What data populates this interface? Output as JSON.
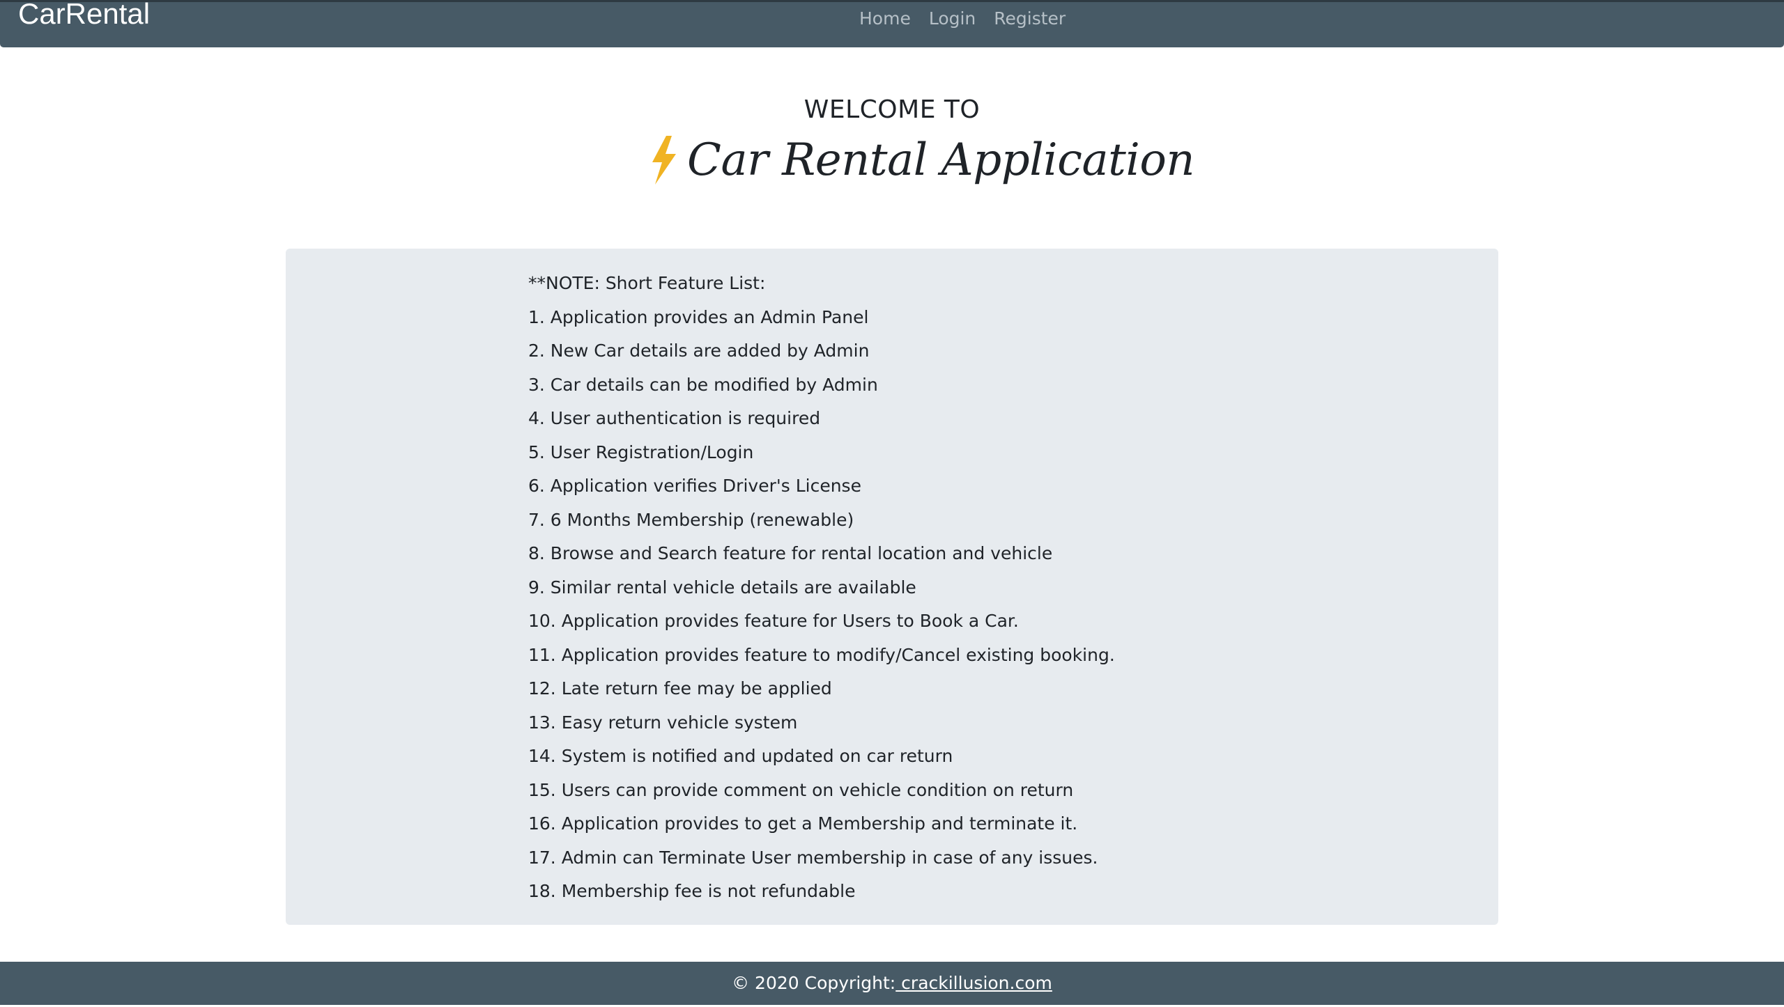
{
  "navbar": {
    "brand": "CarRental",
    "links": [
      {
        "label": "Home"
      },
      {
        "label": "Login"
      },
      {
        "label": "Register"
      }
    ]
  },
  "hero": {
    "welcome": "WELCOME TO",
    "app_title": "Car Rental Application",
    "icon": "lightning-bolt-icon",
    "icon_color": "#f0b323"
  },
  "notes": {
    "heading": "**NOTE: Short Feature List:",
    "items": [
      "1. Application provides an Admin Panel",
      "2. New Car details are added by Admin",
      "3. Car details can be modified by Admin",
      "4. User authentication is required",
      "5. User Registration/Login",
      "6. Application verifies Driver's License",
      "7. 6 Months Membership (renewable)",
      "8. Browse and Search feature for rental location and vehicle",
      "9. Similar rental vehicle details are available",
      "10. Application provides feature for Users to Book a Car.",
      "11. Application provides feature to modify/Cancel existing booking.",
      "12. Late return fee may be applied",
      "13. Easy return vehicle system",
      "14. System is notified and updated on car return",
      "15. Users can provide comment on vehicle condition on return",
      "16. Application provides to get a Membership and terminate it.",
      "17. Admin can Terminate User membership in case of any issues.",
      "18. Membership fee is not refundable"
    ]
  },
  "footer": {
    "copyright": "© 2020 Copyright:",
    "link": " crackillusion.com"
  },
  "colors": {
    "navbar_bg": "#475a66",
    "notes_bg": "#e7ebef",
    "footer_bg": "#475a66"
  }
}
